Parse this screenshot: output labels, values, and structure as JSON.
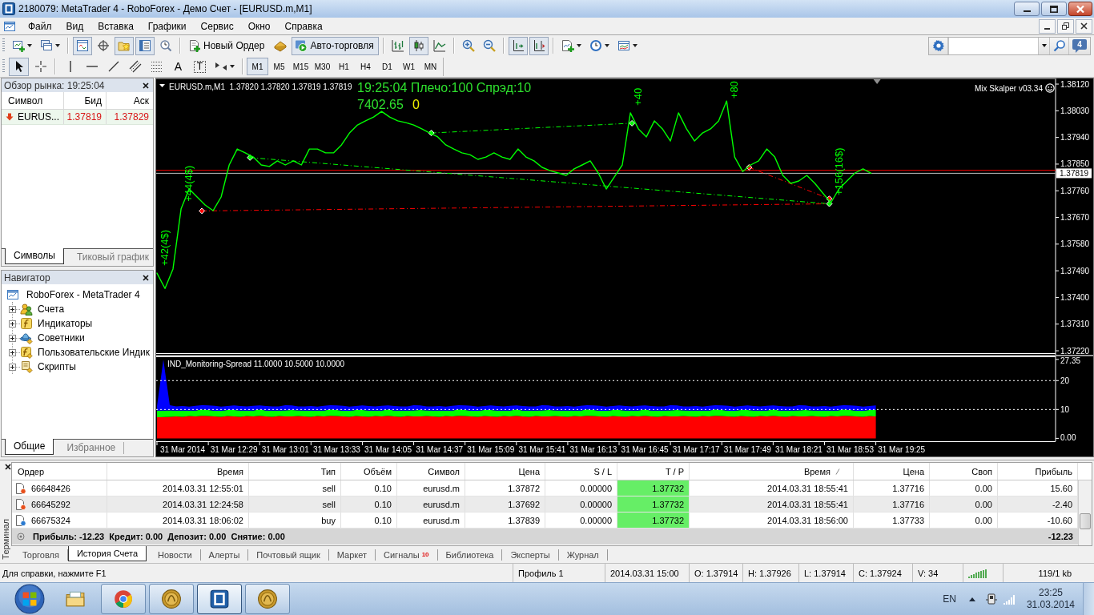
{
  "window": {
    "title": "2180079: MetaTrader 4 - RoboForex - Демо Счет - [EURUSD.m,M1]"
  },
  "menu": [
    "Файл",
    "Вид",
    "Вставка",
    "Графики",
    "Сервис",
    "Окно",
    "Справка"
  ],
  "toolbar": {
    "groups": [
      {
        "items": [
          {
            "kind": "new-chart",
            "dropdown": true,
            "pressed": false
          },
          {
            "kind": "profiles",
            "dropdown": true,
            "pressed": false
          }
        ]
      },
      {
        "items": [
          {
            "kind": "market-watch",
            "pressed": true
          },
          {
            "kind": "data-window",
            "pressed": false
          },
          {
            "kind": "navigator",
            "pressed": true
          },
          {
            "kind": "terminal",
            "pressed": true
          },
          {
            "kind": "tester",
            "pressed": false
          }
        ]
      },
      {
        "items": [
          {
            "kind": "new-order",
            "label": "Новый Ордер",
            "pressed": false
          },
          {
            "kind": "editor",
            "pressed": false
          },
          {
            "kind": "auto-trading",
            "label": "Авто-торговля",
            "pressed": true
          }
        ]
      },
      {
        "items": [
          {
            "kind": "bar-chart",
            "pressed": false
          },
          {
            "kind": "candles",
            "pressed": true
          },
          {
            "kind": "line-chart",
            "pressed": false
          }
        ]
      },
      {
        "items": [
          {
            "kind": "zoom-in",
            "pressed": false
          },
          {
            "kind": "zoom-out",
            "pressed": false
          }
        ]
      },
      {
        "items": [
          {
            "kind": "chart-shift",
            "pressed": true
          },
          {
            "kind": "auto-scroll",
            "pressed": true
          }
        ]
      },
      {
        "items": [
          {
            "kind": "indicators",
            "dropdown": true,
            "pressed": false
          },
          {
            "kind": "periods",
            "dropdown": true,
            "pressed": false
          },
          {
            "kind": "templates",
            "dropdown": true,
            "pressed": false
          }
        ]
      }
    ],
    "messages": "4"
  },
  "drawing_toolbar": {
    "groups": [
      {
        "items": [
          {
            "kind": "cursor",
            "pressed": true
          },
          {
            "kind": "crosshair",
            "pressed": false
          }
        ]
      },
      {
        "items": [
          {
            "kind": "vertical-line",
            "pressed": false
          },
          {
            "kind": "horizontal-line",
            "pressed": false
          },
          {
            "kind": "trend-line",
            "pressed": false
          },
          {
            "kind": "channel",
            "pressed": false
          },
          {
            "kind": "fibo",
            "pressed": false
          },
          {
            "kind": "text",
            "glyph": "A",
            "pressed": false
          },
          {
            "kind": "text-label",
            "glyph": "T",
            "pressed": false
          },
          {
            "kind": "arrows",
            "dropdown": true,
            "pressed": false
          }
        ]
      }
    ]
  },
  "timeframes": [
    {
      "label": "M1",
      "selected": true
    },
    {
      "label": "M5",
      "selected": false
    },
    {
      "label": "M15",
      "selected": false
    },
    {
      "label": "M30",
      "selected": false
    },
    {
      "label": "H1",
      "selected": false
    },
    {
      "label": "H4",
      "selected": false
    },
    {
      "label": "D1",
      "selected": false
    },
    {
      "label": "W1",
      "selected": false
    },
    {
      "label": "MN",
      "selected": false
    }
  ],
  "market_watch": {
    "title": "Обзор рынка: 19:25:04",
    "columns": [
      "Символ",
      "Бид",
      "Аск"
    ],
    "rows": [
      {
        "symbol": "EURUS...",
        "bid": "1.37819",
        "ask": "1.37829",
        "falling": true
      }
    ],
    "tabs": [
      {
        "label": "Символы",
        "selected": true
      },
      {
        "label": "Тиковый график",
        "selected": false
      }
    ]
  },
  "navigator": {
    "title": "Навигатор",
    "tree": {
      "label": "RoboForex - MetaTrader 4",
      "children": [
        {
          "kind": "accounts",
          "label": "Счета",
          "expanded": false
        },
        {
          "kind": "indicators",
          "label": "Индикаторы",
          "expanded": false
        },
        {
          "kind": "experts",
          "label": "Советники",
          "expanded": false
        },
        {
          "kind": "custom",
          "label": "Пользовательские Индик",
          "expanded": false
        },
        {
          "kind": "scripts",
          "label": "Скрипты",
          "expanded": false
        }
      ]
    },
    "tabs": [
      {
        "label": "Общие",
        "selected": true
      },
      {
        "label": "Избранное",
        "selected": false
      }
    ]
  },
  "chart": {
    "info": "19:25:04 Плечо:100 Спрэд:10",
    "balance": "7402.65",
    "balance_change": "0",
    "expert": "Mix Skalper v03.34",
    "chart_data": {
      "type": "line",
      "title": "EURUSD.m,M1  1.37820 1.37820 1.37819 1.37819",
      "categories": [
        null,
        null,
        null,
        null,
        null,
        null,
        null,
        null,
        null,
        null,
        null,
        null,
        null,
        null,
        null,
        null,
        null,
        null,
        null,
        null,
        null,
        null,
        null,
        null,
        null,
        null,
        null,
        null,
        null,
        null,
        null,
        null,
        null,
        null,
        null,
        null,
        null,
        null,
        null,
        null,
        null,
        null,
        null,
        null,
        null,
        null,
        null,
        null,
        null,
        null,
        null,
        null,
        null,
        null,
        null,
        null,
        null,
        null,
        null,
        null,
        null,
        null,
        null,
        null,
        null,
        null,
        null,
        null,
        null,
        null,
        null,
        null,
        null,
        null,
        null,
        null,
        null,
        null,
        null,
        null,
        null,
        null,
        null,
        null,
        null,
        null,
        null,
        null,
        null,
        null,
        null,
        null,
        null,
        null,
        null,
        null,
        null,
        null,
        null,
        null,
        null,
        null,
        null,
        null,
        null,
        null,
        null,
        null,
        null,
        null,
        null,
        null,
        null
      ],
      "series": [
        {
          "color": "#00ff00",
          "values": [
            1.37482,
            1.3743,
            1.37496,
            1.37699,
            1.37766,
            1.37739,
            1.37712,
            1.37693,
            1.37739,
            1.37847,
            1.37901,
            1.37888,
            1.37874,
            1.37847,
            1.37842,
            1.37861,
            1.37847,
            1.37861,
            1.37847,
            1.37901,
            1.37901,
            1.37888,
            1.37888,
            1.37915,
            1.37955,
            1.37982,
            1.37996,
            1.38009,
            1.38028,
            1.38009,
            1.37996,
            1.3799,
            1.37982,
            1.37969,
            1.37955,
            1.37942,
            1.37915,
            1.37901,
            1.37888,
            1.37882,
            1.37866,
            1.37874,
            1.37888,
            1.37874,
            1.37866,
            1.37901,
            1.37874,
            1.37861,
            1.37839,
            1.37828,
            1.3782,
            1.37812,
            1.37834,
            1.37847,
            1.37861,
            1.3782,
            1.37766,
            1.37806,
            1.37847,
            1.38023,
            1.37969,
            1.37942,
            1.37996,
            1.37969,
            1.37928,
            1.38023,
            1.37969,
            1.37928,
            1.37955,
            1.37969,
            1.37996,
            1.38063,
            1.37874,
            1.37825,
            1.37847,
            1.37861,
            1.37901,
            1.37874,
            1.37812,
            1.37785,
            1.37793,
            1.37812,
            1.37785,
            1.37752,
            1.3772,
            1.37766,
            1.37793,
            1.3782,
            1.37834,
            1.37819,
            null,
            null,
            null,
            null,
            null,
            null,
            null,
            null,
            null,
            null,
            null,
            null,
            null,
            null,
            null,
            null,
            null,
            null,
            null,
            null,
            null,
            null,
            null
          ]
        }
      ],
      "ylim": [
        1.37212,
        1.38139
      ],
      "yticks": [
        {
          "value": 1.3812,
          "label": "1.38120"
        },
        {
          "value": 1.3803,
          "label": "1.38030"
        },
        {
          "value": 1.3794,
          "label": "1.37940"
        },
        {
          "value": 1.3785,
          "label": "1.37850"
        },
        {
          "value": 1.3776,
          "label": "1.37760"
        },
        {
          "value": 1.3767,
          "label": "1.37670"
        },
        {
          "value": 1.3758,
          "label": "1.37580"
        },
        {
          "value": 1.3749,
          "label": "1.37490"
        },
        {
          "value": 1.374,
          "label": "1.37400"
        },
        {
          "value": 1.3731,
          "label": "1.37310"
        },
        {
          "value": 1.3722,
          "label": "1.37220"
        }
      ],
      "ref_lines": [
        {
          "axis": "y",
          "value": 1.37829,
          "color": "#ff0000"
        },
        {
          "axis": "y",
          "value": 1.37819,
          "color": "#c0c0c0",
          "label": "1.37819"
        }
      ],
      "annotations": [
        "+42(4$)",
        "+44(4$)",
        "+40",
        "+80",
        "+156(16$)"
      ]
    }
  },
  "indicator": {
    "chart_data": {
      "type": "area",
      "title": "IND_Monitoring-Spread 11.0000 10.5000 10.0000",
      "stacked": true,
      "categories": [
        null,
        null,
        null,
        null,
        "31 Mar 2014",
        null,
        null,
        null,
        null,
        null,
        null,
        null,
        "31 Mar 12:29",
        null,
        null,
        null,
        null,
        null,
        null,
        null,
        "31 Mar 13:01",
        null,
        null,
        null,
        null,
        null,
        null,
        null,
        "31 Mar 13:33",
        null,
        null,
        null,
        null,
        null,
        null,
        null,
        "31 Mar 14:05",
        null,
        null,
        null,
        null,
        null,
        null,
        null,
        "31 Mar 14:37",
        null,
        null,
        null,
        null,
        null,
        null,
        null,
        "31 Mar 15:09",
        null,
        null,
        null,
        null,
        null,
        null,
        null,
        "31 Mar 15:41",
        null,
        null,
        null,
        null,
        null,
        null,
        null,
        "31 Mar 16:13",
        null,
        null,
        null,
        null,
        null,
        null,
        null,
        "31 Mar 16:45",
        null,
        null,
        null,
        null,
        null,
        null,
        null,
        "31 Mar 17:17",
        null,
        null,
        null,
        null,
        null,
        null,
        null,
        "31 Mar 17:49",
        null,
        null,
        null,
        null,
        null,
        null,
        null,
        "31 Mar 18:21",
        null,
        null,
        null,
        null,
        null,
        null,
        null,
        "31 Mar 18:53",
        null,
        null,
        null,
        null,
        null,
        null,
        null,
        "31 Mar 19:25",
        null,
        null,
        null,
        null,
        null,
        null,
        null,
        null,
        null,
        null,
        null,
        null,
        null,
        null,
        null,
        null,
        null,
        null,
        null,
        null,
        null,
        null,
        null,
        null
      ],
      "series": [
        {
          "color": "#ff0000",
          "values": [
            7.3,
            7.4,
            7.5,
            7.6,
            7.5,
            7.7,
            7.6,
            7.8,
            7.7,
            7.6,
            7.5,
            7.7,
            7.6,
            7.5,
            7.7,
            7.6,
            7.8,
            7.6,
            7.5,
            7.7,
            7.6,
            7.6,
            7.7,
            7.6,
            7.5,
            7.7,
            7.6,
            7.8,
            7.7,
            7.6,
            7.5,
            7.7,
            7.6,
            7.5,
            7.7,
            7.6,
            7.8,
            7.6,
            7.5,
            7.7,
            7.6,
            7.6,
            7.7,
            7.6,
            7.5,
            7.7,
            7.6,
            7.8,
            7.7,
            7.6,
            7.5,
            7.7,
            7.6,
            7.5,
            7.7,
            7.6,
            7.8,
            7.6,
            7.5,
            7.7,
            7.6,
            7.6,
            7.7,
            7.6,
            7.5,
            7.7,
            7.6,
            7.8,
            7.7,
            7.6,
            7.5,
            7.7,
            7.6,
            7.5,
            7.7,
            7.6,
            7.8,
            7.6,
            7.5,
            7.7,
            7.6,
            7.6,
            7.7,
            7.6,
            7.5,
            7.7,
            7.6,
            7.8,
            7.7,
            7.6,
            7.5,
            7.7,
            7.6,
            7.5,
            7.7,
            7.6,
            7.8,
            7.6,
            7.5,
            7.7,
            7.6,
            7.6,
            7.7,
            7.6,
            7.5,
            7.7,
            7.6,
            7.8,
            7.7,
            7.6,
            7.5,
            7.7,
            7.6,
            null,
            null,
            null,
            null,
            null,
            null,
            null,
            null,
            null,
            null,
            null,
            null,
            null,
            null,
            null,
            null,
            null,
            null,
            null,
            null,
            null,
            null,
            null,
            null,
            null,
            null,
            null,
            null
          ]
        },
        {
          "color": "#00ff00",
          "values": [
            2.3,
            2.2,
            2.2,
            2.0,
            2.1,
            1.9,
            2.0,
            2.2,
            2.1,
            1.9,
            2.0,
            2.1,
            2.2,
            2.1,
            1.9,
            2.0,
            2.2,
            2.0,
            2.1,
            1.9,
            2.1,
            2.2,
            2.0,
            2.0,
            2.1,
            1.9,
            2.0,
            2.2,
            2.1,
            1.9,
            2.0,
            2.1,
            2.2,
            2.1,
            1.9,
            2.0,
            2.2,
            2.0,
            2.1,
            1.9,
            2.1,
            2.2,
            2.0,
            2.0,
            2.1,
            1.9,
            2.0,
            2.2,
            2.1,
            1.9,
            2.0,
            2.1,
            2.2,
            2.1,
            1.9,
            2.0,
            2.2,
            2.0,
            2.1,
            1.9,
            2.1,
            2.2,
            2.0,
            2.0,
            2.1,
            1.9,
            2.0,
            2.2,
            2.1,
            1.9,
            2.0,
            2.1,
            2.2,
            2.1,
            1.9,
            2.0,
            2.2,
            2.0,
            2.1,
            1.9,
            2.1,
            2.2,
            2.0,
            2.0,
            2.1,
            1.9,
            2.0,
            2.2,
            2.1,
            1.9,
            2.0,
            2.1,
            2.2,
            2.1,
            1.9,
            2.0,
            2.2,
            2.0,
            2.1,
            1.9,
            2.1,
            2.2,
            2.0,
            2.0,
            2.1,
            1.9,
            2.0,
            2.2,
            2.1,
            1.9,
            2.0,
            2.1,
            2.2,
            null,
            null,
            null,
            null,
            null,
            null,
            null,
            null,
            null,
            null,
            null,
            null,
            null,
            null,
            null,
            null,
            null,
            null,
            null,
            null,
            null,
            null,
            null,
            null,
            null,
            null,
            null,
            null
          ]
        },
        {
          "color": "#0000ff",
          "values": [
            1.5,
            17.6,
            1.8,
            1.5,
            1.6,
            1.4,
            1.7,
            1.5,
            1.6,
            1.8,
            1.5,
            1.4,
            1.6,
            1.6,
            1.5,
            1.7,
            1.4,
            1.6,
            1.5,
            1.5,
            1.8,
            1.6,
            1.4,
            1.5,
            1.6,
            1.4,
            1.7,
            1.5,
            1.6,
            1.8,
            1.5,
            1.4,
            1.6,
            1.6,
            1.5,
            1.7,
            1.4,
            1.6,
            1.5,
            1.5,
            1.8,
            1.6,
            1.4,
            1.5,
            1.6,
            1.4,
            1.7,
            1.5,
            1.6,
            1.8,
            1.5,
            1.4,
            1.6,
            1.6,
            1.5,
            1.7,
            1.4,
            1.6,
            1.5,
            1.5,
            1.8,
            1.6,
            1.4,
            1.5,
            1.6,
            1.4,
            1.7,
            1.5,
            1.6,
            1.8,
            1.5,
            1.4,
            1.6,
            1.6,
            1.5,
            1.7,
            1.4,
            1.6,
            1.5,
            1.5,
            1.8,
            1.6,
            1.4,
            1.5,
            1.6,
            1.4,
            1.7,
            1.5,
            1.6,
            1.8,
            1.5,
            1.4,
            1.6,
            1.6,
            1.5,
            1.7,
            1.4,
            1.6,
            1.5,
            1.5,
            1.8,
            1.6,
            1.4,
            1.5,
            1.6,
            1.4,
            1.7,
            1.5,
            1.6,
            1.8,
            1.5,
            1.4,
            1.6,
            null,
            null,
            null,
            null,
            null,
            null,
            null,
            null,
            null,
            null,
            null,
            null,
            null,
            null,
            null,
            null,
            null,
            null,
            null,
            null,
            null,
            null,
            null,
            null,
            null,
            null,
            null,
            null
          ]
        }
      ],
      "ylim": [
        -1,
        28.4
      ],
      "yticks": [
        {
          "value": 27.35,
          "label": "27.35"
        },
        20,
        10,
        {
          "value": 0,
          "label": "0.00"
        }
      ]
    }
  },
  "terminal": {
    "label": "Терминал",
    "columns": [
      {
        "label": "Ордер",
        "sorted": false
      },
      {
        "label": "Время",
        "sorted": false
      },
      {
        "label": "Тип",
        "sorted": false
      },
      {
        "label": "Объём",
        "sorted": false
      },
      {
        "label": "Символ",
        "sorted": false
      },
      {
        "label": "Цена",
        "sorted": false
      },
      {
        "label": "S / L",
        "sorted": false
      },
      {
        "label": "T / P",
        "sorted": false
      },
      {
        "label": "Время",
        "sorted": true
      },
      {
        "label": "Цена",
        "sorted": false
      },
      {
        "label": "Своп",
        "sorted": false
      },
      {
        "label": "Прибыль",
        "sorted": false
      }
    ],
    "rows": [
      {
        "kind": "sell",
        "order": "66648426",
        "open_time": "2014.03.31 12:55:01",
        "type": "sell",
        "volume": "0.10",
        "symbol": "eurusd.m",
        "open_price": "1.37872",
        "sl": "0.00000",
        "tp": "1.37732",
        "tp_hit": true,
        "close_time": "2014.03.31 18:55:41",
        "close_price": "1.37716",
        "swap": "0.00",
        "profit": "15.60"
      },
      {
        "kind": "sell",
        "order": "66645292",
        "open_time": "2014.03.31 12:24:58",
        "type": "sell",
        "volume": "0.10",
        "symbol": "eurusd.m",
        "open_price": "1.37692",
        "sl": "0.00000",
        "tp": "1.37732",
        "tp_hit": true,
        "close_time": "2014.03.31 18:55:41",
        "close_price": "1.37716",
        "swap": "0.00",
        "profit": "-2.40"
      },
      {
        "kind": "buy",
        "order": "66675324",
        "open_time": "2014.03.31 18:06:02",
        "type": "buy",
        "volume": "0.10",
        "symbol": "eurusd.m",
        "open_price": "1.37839",
        "sl": "0.00000",
        "tp": "1.37732",
        "tp_hit": true,
        "close_time": "2014.03.31 18:56:00",
        "close_price": "1.37733",
        "swap": "0.00",
        "profit": "-10.60"
      }
    ],
    "summary": "Прибыль: -12.23  Кредит: 0.00  Депозит: 0.00  Снятие: 0.00",
    "total": "-12.23",
    "tabs": [
      {
        "label": "Торговля",
        "selected": false
      },
      {
        "label": "История Счета",
        "selected": true
      },
      {
        "label": "Новости",
        "selected": false
      },
      {
        "label": "Алерты",
        "selected": false
      },
      {
        "label": "Почтовый ящик",
        "selected": false
      },
      {
        "label": "Маркет",
        "selected": false
      },
      {
        "label": "Сигналы",
        "badge": "10",
        "selected": false
      },
      {
        "label": "Библиотека",
        "selected": false
      },
      {
        "label": "Эксперты",
        "selected": false
      },
      {
        "label": "Журнал",
        "selected": false
      }
    ]
  },
  "status_bar": {
    "help": "Для справки, нажмите F1",
    "profile": "Профиль 1",
    "bar_time": "2014.03.31 15:00",
    "open": "O: 1.37914",
    "high": "H: 1.37926",
    "low": "L: 1.37914",
    "close": "C: 1.37924",
    "volume": "V: 34",
    "traffic": "119/1 kb"
  },
  "taskbar": {
    "apps": [
      {
        "kind": "folder",
        "running": false,
        "selected": false
      },
      {
        "kind": "browser",
        "running": true,
        "selected": false
      },
      {
        "kind": "coin",
        "running": true,
        "selected": false
      },
      {
        "kind": "tile",
        "running": true,
        "selected": true
      },
      {
        "kind": "coin",
        "running": true,
        "selected": false
      }
    ],
    "language": "EN",
    "time": "23:25",
    "date": "31.03.2014"
  }
}
